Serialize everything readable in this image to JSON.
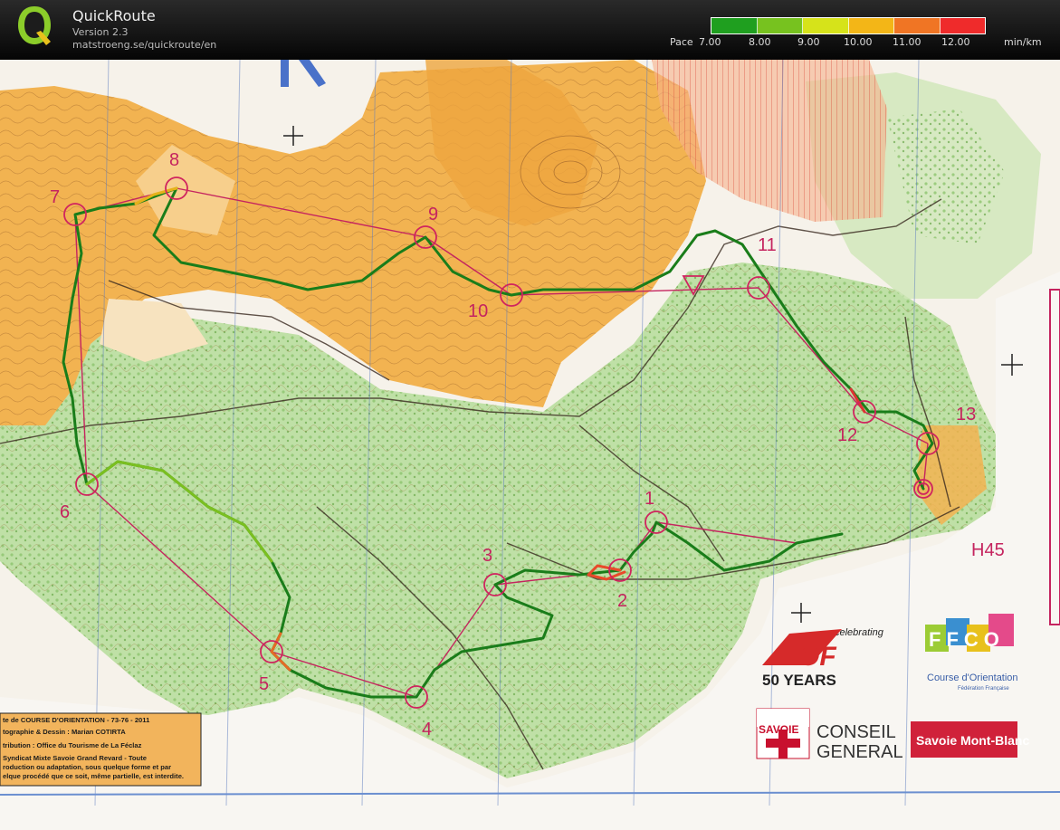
{
  "app": {
    "title": "QuickRoute",
    "version": "Version 2.3",
    "url": "matstroeng.se/quickroute/en"
  },
  "pace_legend": {
    "label": "Pace",
    "ticks": [
      "7.00",
      "8.00",
      "9.00",
      "10.00",
      "11.00",
      "12.00"
    ],
    "unit": "min/km",
    "colors": [
      "#1f9f1f",
      "#77c21f",
      "#d6e31a",
      "#f3b617",
      "#f07524",
      "#ef2b2b"
    ]
  },
  "map": {
    "class_label": "H45",
    "controls": [
      "1",
      "2",
      "3",
      "4",
      "5",
      "6",
      "7",
      "8",
      "9",
      "10",
      "11",
      "12",
      "13"
    ],
    "credits": [
      "te de COURSE D'ORIENTATION - 73-76 - 2011",
      "tographie & Dessin : Marian COTIRTA",
      "tribution : Office du Tourisme de La Féclaz",
      "Syndicat Mixte Savoie Grand Revard - Toute",
      "roduction ou adaptation, sous quelque forme et par",
      "elque procédé que ce soit, même partielle, est interdite."
    ],
    "sponsors": {
      "of50": {
        "top": "celebrating",
        "mark": "OF",
        "years": "50 YEARS"
      },
      "ffco": {
        "mark": "FFCO",
        "name": "Course d'Orientation",
        "sub": "Fédération Française"
      },
      "savoie": {
        "label": "SAVOIE",
        "line1": "CONSEIL",
        "line2": "GENERAL"
      },
      "smb": "Savoie Mont-Blanc"
    }
  }
}
